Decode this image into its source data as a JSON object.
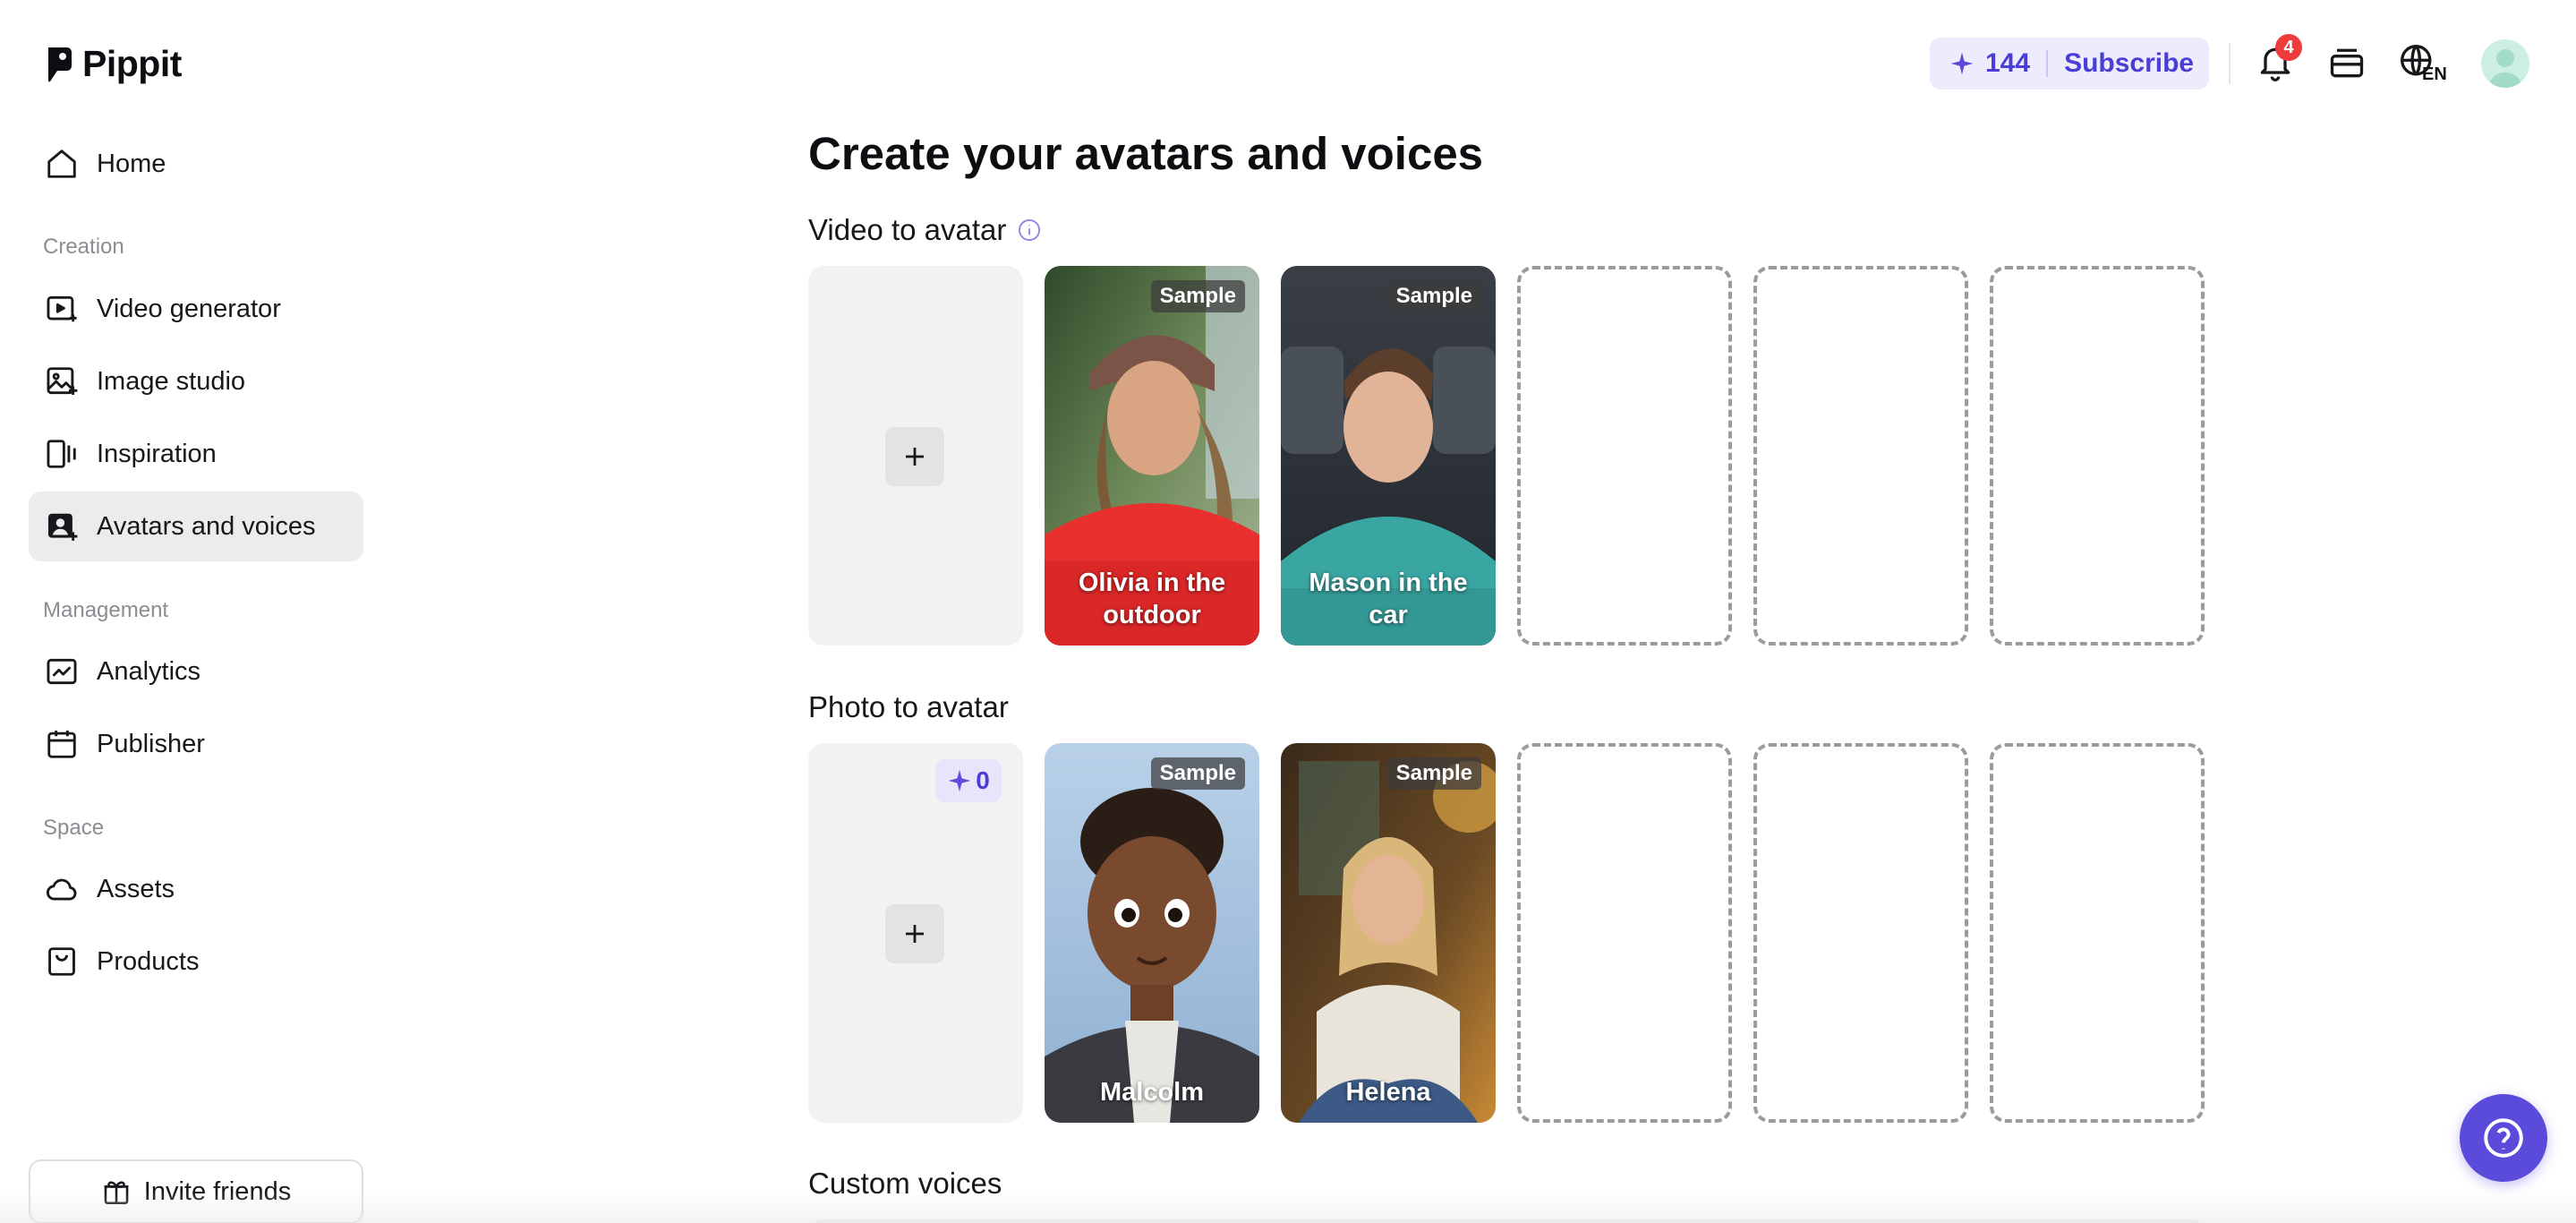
{
  "app": {
    "name": "Pippit"
  },
  "sidebar": {
    "home": "Home",
    "sections": {
      "creation": "Creation",
      "management": "Management",
      "space": "Space"
    },
    "items": {
      "video_generator": "Video generator",
      "image_studio": "Image studio",
      "inspiration": "Inspiration",
      "avatars_and_voices": "Avatars and voices",
      "analytics": "Analytics",
      "publisher": "Publisher",
      "assets": "Assets",
      "products": "Products"
    },
    "active_item": "Avatars and voices",
    "invite_label": "Invite friends"
  },
  "header": {
    "credits": "144",
    "subscribe_label": "Subscribe",
    "notification_count": "4",
    "language": "EN"
  },
  "main": {
    "title": "Create your avatars and voices",
    "video_to_avatar": {
      "title": "Video to avatar",
      "samples": [
        {
          "name": "Olivia in the outdoor",
          "badge": "Sample"
        },
        {
          "name": "Mason in the car",
          "badge": "Sample"
        }
      ]
    },
    "photo_to_avatar": {
      "title": "Photo to avatar",
      "cost": "0",
      "samples": [
        {
          "name": "Malcolm",
          "badge": "Sample"
        },
        {
          "name": "Helena",
          "badge": "Sample"
        }
      ]
    },
    "custom_voices": {
      "title": "Custom voices"
    }
  },
  "colors": {
    "accent": "#5b4bdb",
    "accent_text": "#4a3fd4",
    "active_nav_bg": "#ececec",
    "badge_red": "#ef3b3b"
  }
}
